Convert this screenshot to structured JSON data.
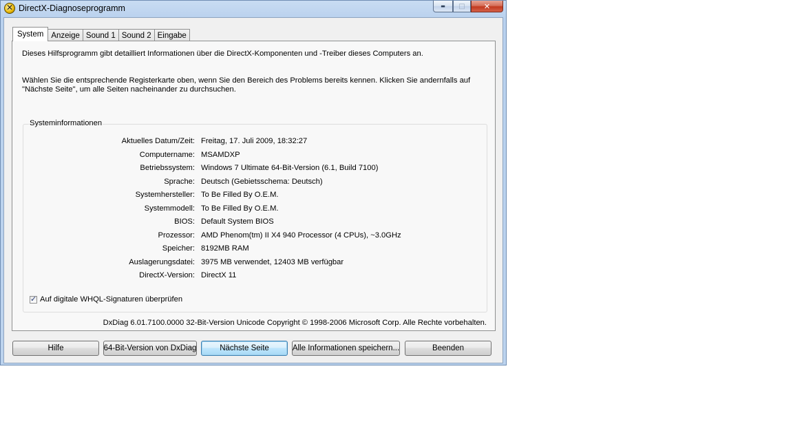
{
  "window": {
    "title": "DirectX-Diagnoseprogramm",
    "controls": {
      "minimize": "▬",
      "maximize": "□",
      "close": "✕"
    }
  },
  "tabs": [
    {
      "label": "System",
      "active": true
    },
    {
      "label": "Anzeige",
      "active": false
    },
    {
      "label": "Sound 1",
      "active": false
    },
    {
      "label": "Sound 2",
      "active": false
    },
    {
      "label": "Eingabe",
      "active": false
    }
  ],
  "intro": {
    "line1": "Dieses Hilfsprogramm gibt detailliert Informationen über die DirectX-Komponenten und -Treiber dieses Computers an.",
    "line2": "Wählen Sie die entsprechende Registerkarte oben, wenn Sie den Bereich des Problems bereits kennen. Klicken Sie andernfalls auf \"Nächste Seite\", um alle Seiten nacheinander zu durchsuchen."
  },
  "system_info": {
    "legend": "Systeminformationen",
    "rows": [
      {
        "label": "Aktuelles Datum/Zeit:",
        "value": "Freitag, 17. Juli 2009, 18:32:27"
      },
      {
        "label": "Computername:",
        "value": "MSAMDXP"
      },
      {
        "label": "Betriebssystem:",
        "value": "Windows 7 Ultimate 64-Bit-Version (6.1, Build 7100)"
      },
      {
        "label": "Sprache:",
        "value": "Deutsch (Gebietsschema: Deutsch)"
      },
      {
        "label": "Systemhersteller:",
        "value": "To Be Filled By O.E.M."
      },
      {
        "label": "Systemmodell:",
        "value": "To Be Filled By O.E.M."
      },
      {
        "label": "BIOS:",
        "value": "Default System BIOS"
      },
      {
        "label": "Prozessor:",
        "value": "AMD Phenom(tm) II X4 940 Processor (4 CPUs), ~3.0GHz"
      },
      {
        "label": "Speicher:",
        "value": "8192MB RAM"
      },
      {
        "label": "Auslagerungsdatei:",
        "value": "3975 MB verwendet, 12403 MB verfügbar"
      },
      {
        "label": "DirectX-Version:",
        "value": "DirectX 11"
      }
    ],
    "whql_checkbox": {
      "label": "Auf digitale WHQL-Signaturen überprüfen",
      "checked": true
    }
  },
  "copyright": "DxDiag 6.01.7100.0000 32-Bit-Version Unicode Copyright © 1998-2006 Microsoft Corp. Alle Rechte vorbehalten.",
  "buttons": {
    "help": "Hilfe",
    "bit64": "64-Bit-Version von DxDiag",
    "next": "Nächste Seite",
    "save_all": "Alle Informationen speichern...",
    "exit": "Beenden"
  }
}
